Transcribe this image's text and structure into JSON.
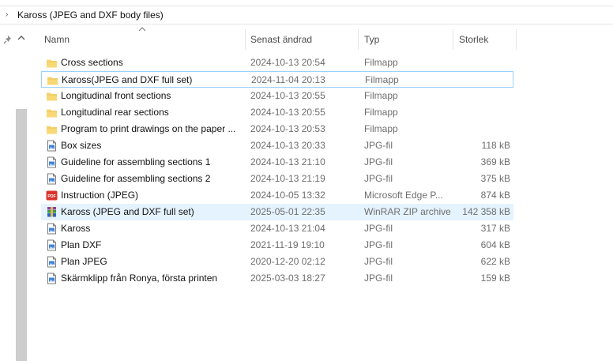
{
  "breadcrumb": {
    "chevron": "›",
    "path": "Kaross (JPEG and DXF body files)"
  },
  "columns": {
    "name": "Namn",
    "modified": "Senast ändrad",
    "type": "Typ",
    "size": "Storlek"
  },
  "files": [
    {
      "name": "Cross sections",
      "modified": "2024-10-13 20:54",
      "type": "Filmapp",
      "size": "",
      "icon": "folder-icon"
    },
    {
      "name": "Kaross(JPEG and DXF full set)",
      "modified": "2024-11-04 20:13",
      "type": "Filmapp",
      "size": "",
      "icon": "folder-icon"
    },
    {
      "name": "Longitudinal front sections",
      "modified": "2024-10-13 20:55",
      "type": "Filmapp",
      "size": "",
      "icon": "folder-icon"
    },
    {
      "name": "Longitudinal rear sections",
      "modified": "2024-10-13 20:55",
      "type": "Filmapp",
      "size": "",
      "icon": "folder-icon"
    },
    {
      "name": "Program to print drawings on the paper ...",
      "modified": "2024-10-13 20:53",
      "type": "Filmapp",
      "size": "",
      "icon": "folder-icon"
    },
    {
      "name": "Box sizes",
      "modified": "2024-10-13 20:33",
      "type": "JPG-fil",
      "size": "118 kB",
      "icon": "image-file-icon"
    },
    {
      "name": "Guideline for assembling sections 1",
      "modified": "2024-10-13 21:10",
      "type": "JPG-fil",
      "size": "369 kB",
      "icon": "image-file-icon"
    },
    {
      "name": "Guideline for assembling sections 2",
      "modified": "2024-10-13 21:19",
      "type": "JPG-fil",
      "size": "375 kB",
      "icon": "image-file-icon"
    },
    {
      "name": "Instruction (JPEG)",
      "modified": "2024-10-05 13:32",
      "type": "Microsoft Edge P...",
      "size": "874 kB",
      "icon": "pdf-icon"
    },
    {
      "name": "Kaross (JPEG and DXF full set)",
      "modified": "2025-05-01 22:35",
      "type": "WinRAR ZIP archive",
      "size": "142 358 kB",
      "icon": "winrar-archive-icon"
    },
    {
      "name": "Kaross",
      "modified": "2024-10-13 21:04",
      "type": "JPG-fil",
      "size": "317 kB",
      "icon": "image-file-icon"
    },
    {
      "name": "Plan DXF",
      "modified": "2021-11-19 19:10",
      "type": "JPG-fil",
      "size": "604 kB",
      "icon": "image-file-icon"
    },
    {
      "name": "Plan JPEG",
      "modified": "2020-12-20 02:12",
      "type": "JPG-fil",
      "size": "622 kB",
      "icon": "image-file-icon"
    },
    {
      "name": "Skärmklipp från Ronya, första printen",
      "modified": "2025-03-03 18:27",
      "type": "JPG-fil",
      "size": "159 kB",
      "icon": "image-file-icon"
    }
  ],
  "state": {
    "focused_row": 1,
    "selected_row": 9
  },
  "colors": {
    "selection": "#e5f3ff",
    "focus_border": "#99d1ff",
    "folder": "#f8d775",
    "pdf": "#d9342b"
  },
  "pdf_icon_text": "PDF"
}
